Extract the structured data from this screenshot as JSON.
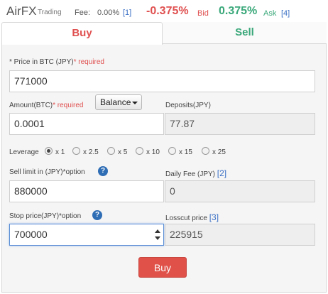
{
  "header": {
    "brand": "AirFX",
    "brand_sub": "Trading",
    "fee_label": "Fee:",
    "fee_value": "0.00%",
    "fee_ref": "[1]",
    "bid_value": "-0.375%",
    "bid_label": "Bid",
    "ask_value": "0.375%",
    "ask_label": "Ask",
    "ask_ref": "[4]"
  },
  "tabs": {
    "buy": "Buy",
    "sell": "Sell"
  },
  "form": {
    "price_label": "* Price in BTC (JPY)",
    "price_req": "* required",
    "price_value": "771000",
    "amount_label": "Amount(BTC)",
    "amount_req": "* required",
    "balance_label": "Balance",
    "amount_value": "0.0001",
    "deposits_label": "Deposits(JPY)",
    "deposits_value": "77.87",
    "leverage_label": "Leverage",
    "leverage_options": [
      "x 1",
      "x 2.5",
      "x 5",
      "x 10",
      "x 15",
      "x 25"
    ],
    "leverage_selected": "x 1",
    "sell_limit_label": "Sell limit in (JPY)*option",
    "sell_limit_value": "880000",
    "daily_fee_label": "Daily Fee (JPY)",
    "daily_fee_ref": "[2]",
    "daily_fee_value": "0",
    "stop_price_label": "Stop price(JPY)*option",
    "stop_price_value": "700000",
    "losscut_label": "Losscut price",
    "losscut_ref": "[3]",
    "losscut_value": "225915",
    "buy_button": "Buy"
  },
  "colors": {
    "bid": "#e05050",
    "ask": "#3aa87a",
    "link": "#3a6fc4",
    "buy_button": "#df5149"
  }
}
